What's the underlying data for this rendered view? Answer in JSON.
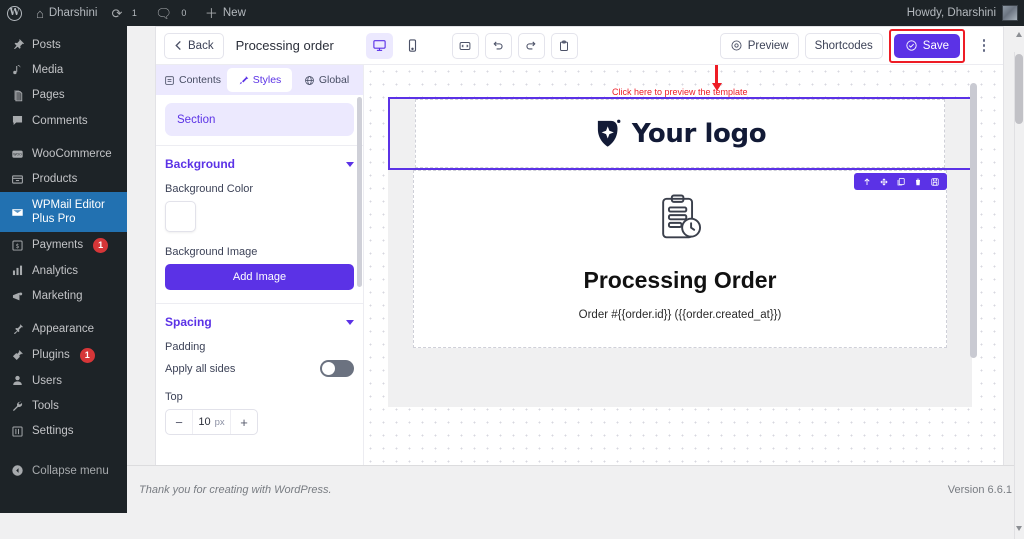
{
  "adminbar": {
    "logo_icon": "wordpress-logo-icon",
    "site": {
      "icon": "home-icon",
      "label": "Dharshini"
    },
    "updates": {
      "icon": "updates-icon",
      "count": "1"
    },
    "comments": {
      "icon": "comment-icon",
      "count": "0"
    },
    "new": {
      "icon": "plus-icon",
      "label": "New"
    },
    "howdy": "Howdy, Dharshini"
  },
  "sidebar": {
    "items": [
      {
        "label": "Posts",
        "icon": "pin-icon",
        "badge": "",
        "active": false
      },
      {
        "label": "Media",
        "icon": "media-icon",
        "badge": "",
        "active": false
      },
      {
        "label": "Pages",
        "icon": "pages-icon",
        "badge": "",
        "active": false
      },
      {
        "label": "Comments",
        "icon": "comment-icon",
        "badge": "",
        "active": false
      },
      {
        "label": "WooCommerce",
        "icon": "woo-icon",
        "badge": "",
        "active": false
      },
      {
        "label": "Products",
        "icon": "products-icon",
        "badge": "",
        "active": false
      },
      {
        "label": "WPMail Editor Plus Pro",
        "icon": "envelope-icon",
        "badge": "",
        "active": true
      },
      {
        "label": "Payments",
        "icon": "payments-icon",
        "badge": "1",
        "active": false
      },
      {
        "label": "Analytics",
        "icon": "analytics-icon",
        "badge": "",
        "active": false
      },
      {
        "label": "Marketing",
        "icon": "megaphone-icon",
        "badge": "",
        "active": false
      },
      {
        "label": "Appearance",
        "icon": "brush-icon",
        "badge": "",
        "active": false
      },
      {
        "label": "Plugins",
        "icon": "plug-icon",
        "badge": "1",
        "active": false
      },
      {
        "label": "Users",
        "icon": "user-icon",
        "badge": "",
        "active": false
      },
      {
        "label": "Tools",
        "icon": "wrench-icon",
        "badge": "",
        "active": false
      },
      {
        "label": "Settings",
        "icon": "settings-icon",
        "badge": "",
        "active": false
      }
    ],
    "collapse": {
      "label": "Collapse menu",
      "icon": "collapse-icon"
    }
  },
  "toolbar": {
    "back_label": "Back",
    "back_icon": "chevron-left-icon",
    "title": "Processing order",
    "devices": [
      {
        "name": "desktop-view",
        "icon": "desktop-icon",
        "active": true
      },
      {
        "name": "mobile-view",
        "icon": "mobile-icon",
        "active": false
      }
    ],
    "actions": [
      {
        "name": "code-view",
        "icon": "code-icon"
      },
      {
        "name": "undo",
        "icon": "undo-icon"
      },
      {
        "name": "redo",
        "icon": "redo-icon"
      },
      {
        "name": "clipboard",
        "icon": "clipboard-icon"
      }
    ],
    "preview_label": "Preview",
    "preview_icon": "eye-circle-icon",
    "shortcodes_label": "Shortcodes",
    "save_label": "Save",
    "save_icon": "check-circle-icon",
    "more_icon": "kebab-menu-icon",
    "save_highlight_color": "#ee1c25",
    "accent_color": "#5b32e6"
  },
  "annotation": {
    "text": "Click here to preview the template",
    "color": "#ee1c25"
  },
  "left_panel": {
    "tabs": [
      {
        "label": "Contents",
        "icon": "contents-icon",
        "active": false
      },
      {
        "label": "Styles",
        "icon": "brush-pen-icon",
        "active": true
      },
      {
        "label": "Global",
        "icon": "globe-icon",
        "active": false
      }
    ],
    "selected_element": "Section",
    "background": {
      "title": "Background",
      "color_label": "Background Color",
      "color_value": "#ffffff",
      "image_label": "Background Image",
      "add_image_label": "Add Image"
    },
    "spacing": {
      "title": "Spacing",
      "padding_label": "Padding",
      "apply_all_label": "Apply all sides",
      "apply_all_on": false,
      "top_label": "Top",
      "top_value": "10",
      "unit": "px",
      "minus": "−",
      "plus": "+"
    }
  },
  "canvas": {
    "logo_section": {
      "logo_text": "Your logo",
      "logo_icon": "shield-sparkle-logo-icon"
    },
    "block_toolbar": [
      {
        "name": "move-up-icon",
        "glyph": "↑"
      },
      {
        "name": "drag-move-icon",
        "glyph": "✣"
      },
      {
        "name": "duplicate-icon",
        "glyph": "⧉"
      },
      {
        "name": "delete-icon",
        "glyph": "🗑"
      },
      {
        "name": "save-block-icon",
        "glyph": "💾"
      }
    ],
    "body_section": {
      "icon": "clipboard-clock-icon",
      "title": "Processing Order",
      "subtitle": "Order #{{order.id}} ({{order.created_at}})"
    }
  },
  "footer": {
    "left": "Thank you for creating with WordPress.",
    "right": "Version 6.6.1"
  }
}
